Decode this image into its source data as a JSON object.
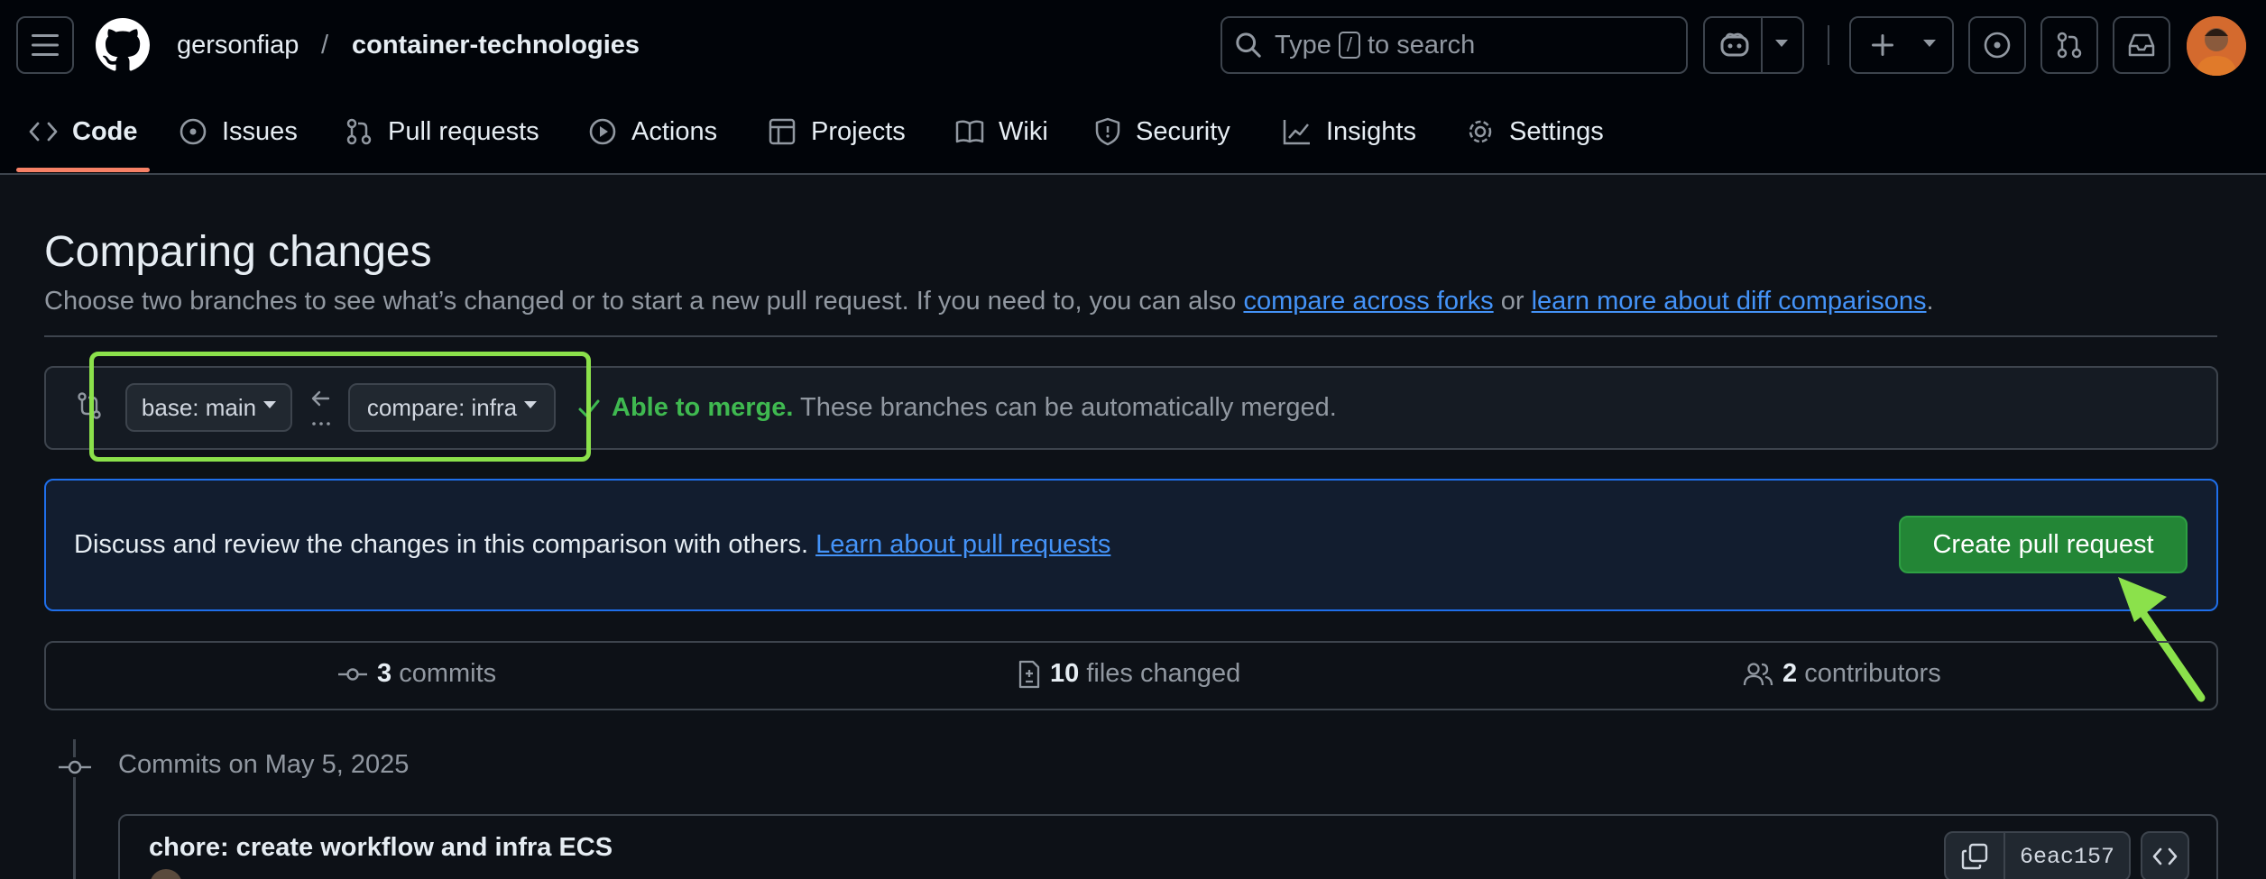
{
  "header": {
    "owner": "gersonfiap",
    "separator": "/",
    "repo": "container-technologies",
    "search": {
      "prefix": "Type",
      "key": "/",
      "suffix": "to search"
    }
  },
  "tabs": [
    {
      "label": "Code",
      "icon": "code-icon",
      "active": true
    },
    {
      "label": "Issues",
      "icon": "issue-opened-icon"
    },
    {
      "label": "Pull requests",
      "icon": "git-pull-request-icon"
    },
    {
      "label": "Actions",
      "icon": "play-icon"
    },
    {
      "label": "Projects",
      "icon": "table-icon"
    },
    {
      "label": "Wiki",
      "icon": "book-icon"
    },
    {
      "label": "Security",
      "icon": "shield-icon"
    },
    {
      "label": "Insights",
      "icon": "graph-icon"
    },
    {
      "label": "Settings",
      "icon": "gear-icon"
    }
  ],
  "compare": {
    "title": "Comparing changes",
    "desc_text": "Choose two branches to see what’s changed or to start a new pull request. If you need to, you can also",
    "link_forks": "compare across forks",
    "desc_or": "or",
    "link_learn_diff": "learn more about diff comparisons",
    "desc_end": ".",
    "base_label": "base: main",
    "compare_label": "compare: infra",
    "merge_status": "Able to merge.",
    "merge_desc": "These branches can be automatically merged."
  },
  "discuss": {
    "text": "Discuss and review the changes in this comparison with others.",
    "link": "Learn about pull requests",
    "button": "Create pull request"
  },
  "stats": {
    "commits_count": "3",
    "commits_label": "commits",
    "files_count": "10",
    "files_label": "files changed",
    "contributors_count": "2",
    "contributors_label": "contributors"
  },
  "commits": {
    "date_header": "Commits on May 5, 2025",
    "items": [
      {
        "message": "chore: create workflow and infra ECS",
        "sha": "6eac157"
      }
    ]
  },
  "colors": {
    "accent_green": "#8be14b",
    "merge_green": "#3fb950",
    "link_blue": "#4493f8",
    "tab_underline": "#f78166"
  }
}
